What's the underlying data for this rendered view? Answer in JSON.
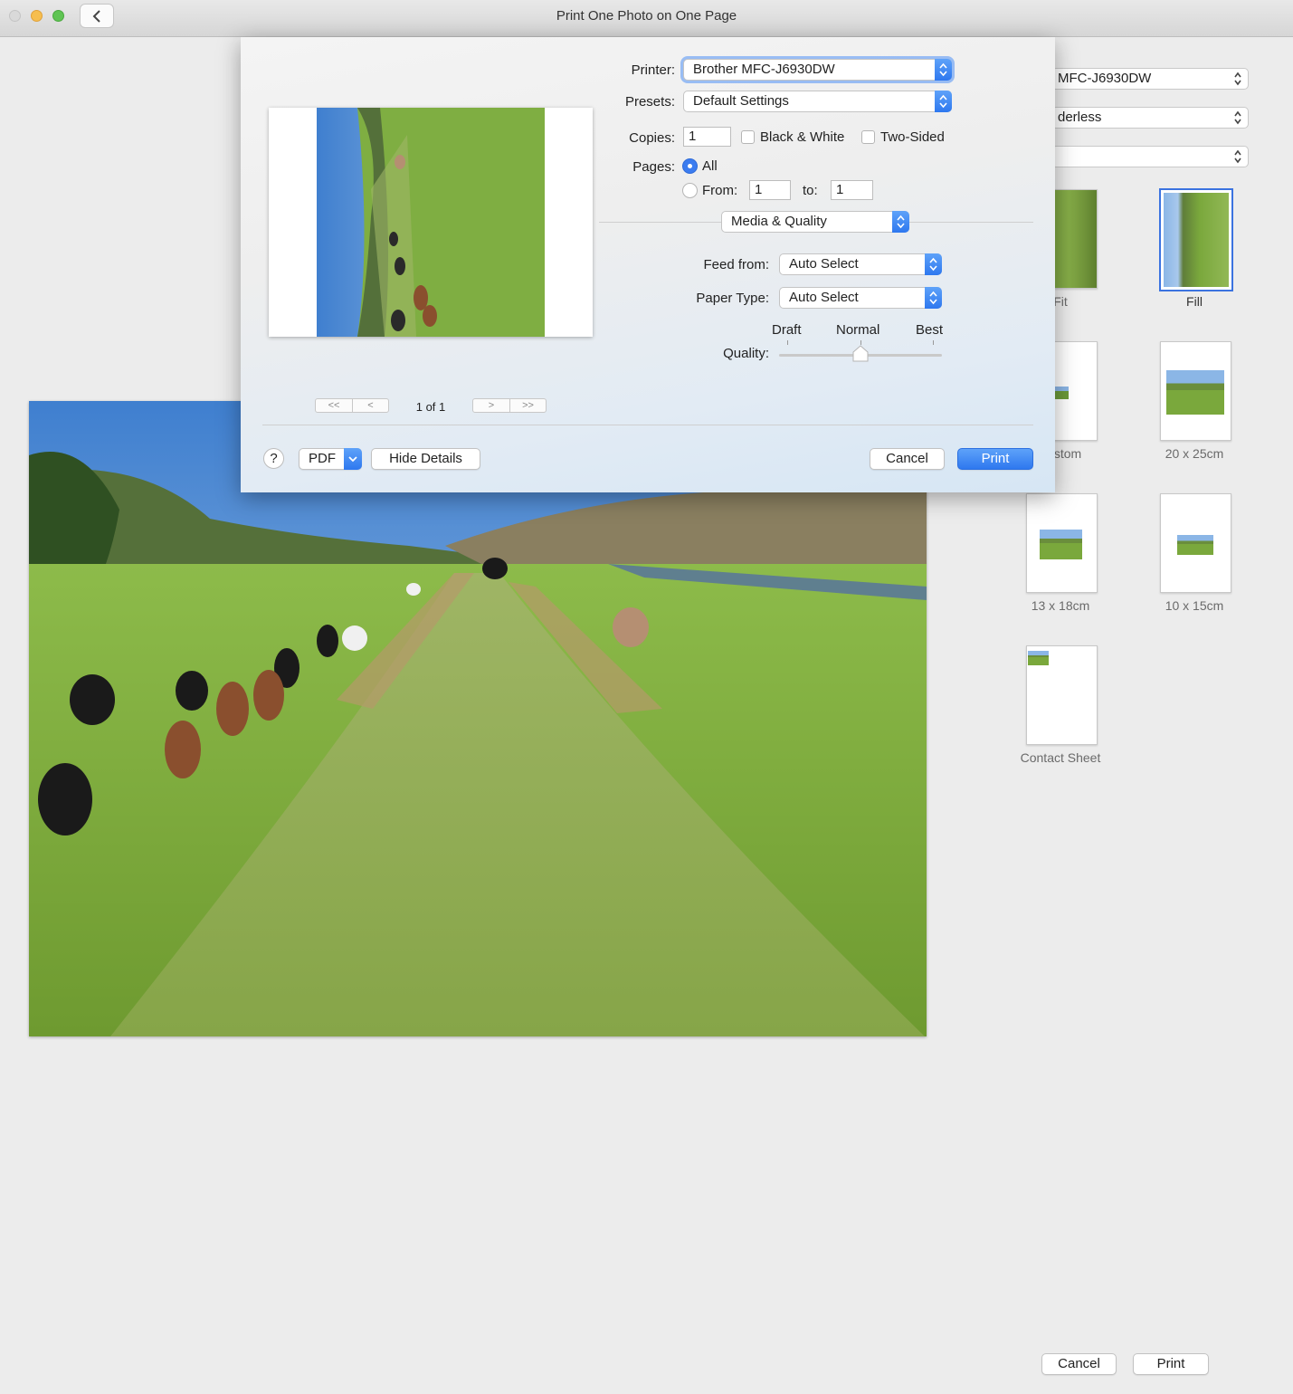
{
  "window": {
    "title": "Print One Photo on One Page"
  },
  "panel": {
    "printer_value": "MFC-J6930DW",
    "paper_value": "derless",
    "third_value": ""
  },
  "thumbnails": [
    {
      "label": "Fit"
    },
    {
      "label": "Fill"
    },
    {
      "label": "stom"
    },
    {
      "label": "20 x 25cm"
    },
    {
      "label": "13 x 18cm"
    },
    {
      "label": "10 x 15cm"
    },
    {
      "label": "Contact Sheet"
    }
  ],
  "bottom": {
    "cancel": "Cancel",
    "print": "Print"
  },
  "dialog": {
    "printer_label": "Printer:",
    "printer_value": "Brother MFC-J6930DW",
    "presets_label": "Presets:",
    "presets_value": "Default Settings",
    "copies_label": "Copies:",
    "copies_value": "1",
    "bw_label": "Black & White",
    "two_sided_label": "Two-Sided",
    "pages_label": "Pages:",
    "pages_all": "All",
    "pages_from_label": "From:",
    "pages_from": "1",
    "pages_to_label": "to:",
    "pages_to": "1",
    "section_value": "Media & Quality",
    "feed_label": "Feed from:",
    "feed_value": "Auto Select",
    "paper_type_label": "Paper Type:",
    "paper_type_value": "Auto Select",
    "quality_label": "Quality:",
    "quality_draft": "Draft",
    "quality_normal": "Normal",
    "quality_best": "Best",
    "quality_level": 0.5,
    "page_indicator": "1 of 1",
    "nav_first": "<<",
    "nav_prev": "<",
    "nav_next": ">",
    "nav_last": ">>",
    "help": "?",
    "pdf": "PDF",
    "hide_details": "Hide Details",
    "cancel": "Cancel",
    "print": "Print"
  },
  "colors": {
    "accent": "#3b7cf0",
    "sky": "#8bb6e6",
    "grass": "#7aa83c"
  }
}
